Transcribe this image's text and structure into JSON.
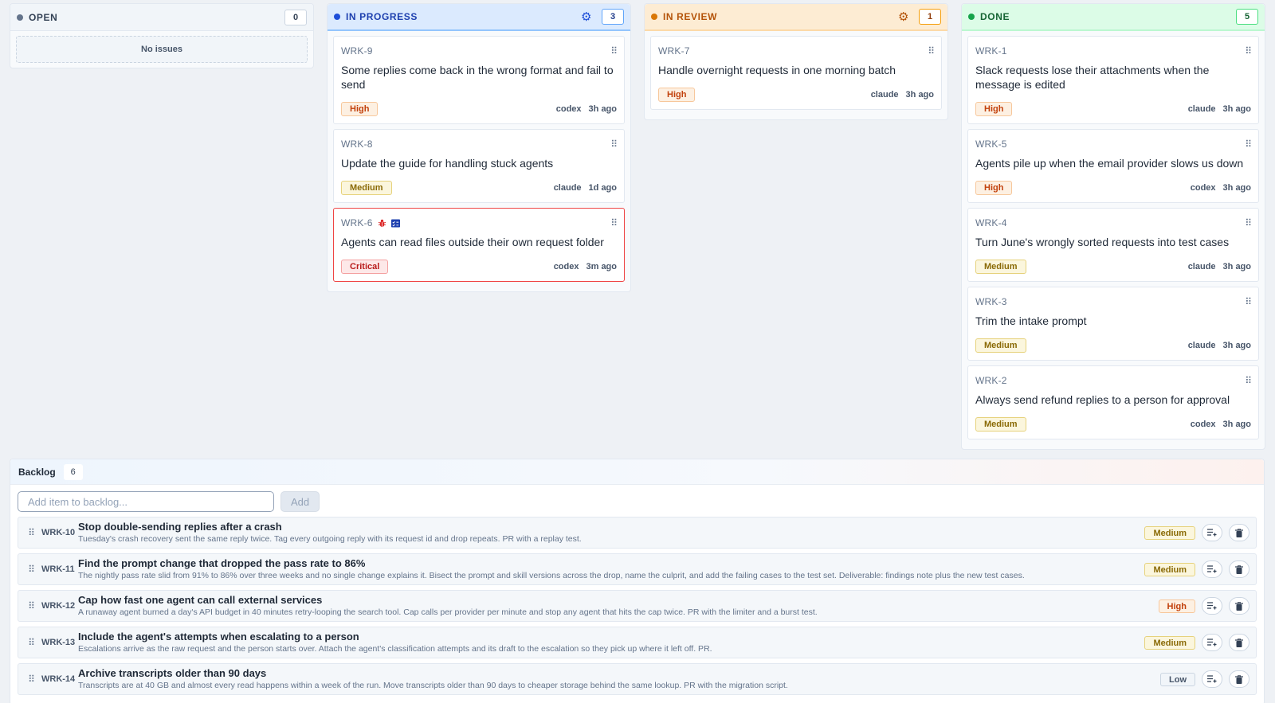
{
  "columns": {
    "open": {
      "label": "OPEN",
      "count": "0",
      "empty_text": "No issues"
    },
    "in_progress": {
      "label": "IN PROGRESS",
      "count": "3",
      "cards": [
        {
          "id": "WRK-9",
          "title": "Some replies come back in the wrong format and fail to send",
          "priority": "High",
          "agent": "codex",
          "time": "3h ago"
        },
        {
          "id": "WRK-8",
          "title": "Update the guide for handling stuck agents",
          "priority": "Medium",
          "agent": "claude",
          "time": "1d ago"
        },
        {
          "id": "WRK-6",
          "title": "Agents can read files outside their own request folder",
          "priority": "Critical",
          "agent": "codex",
          "time": "3m ago",
          "flags": [
            "bug-icon",
            "checklist-icon"
          ]
        }
      ]
    },
    "in_review": {
      "label": "IN REVIEW",
      "count": "1",
      "cards": [
        {
          "id": "WRK-7",
          "title": "Handle overnight requests in one morning batch",
          "priority": "High",
          "agent": "claude",
          "time": "3h ago"
        }
      ]
    },
    "done": {
      "label": "DONE",
      "count": "5",
      "cards": [
        {
          "id": "WRK-1",
          "title": "Slack requests lose their attachments when the message is edited",
          "priority": "High",
          "agent": "claude",
          "time": "3h ago"
        },
        {
          "id": "WRK-5",
          "title": "Agents pile up when the email provider slows us down",
          "priority": "High",
          "agent": "codex",
          "time": "3h ago"
        },
        {
          "id": "WRK-4",
          "title": "Turn June's wrongly sorted requests into test cases",
          "priority": "Medium",
          "agent": "claude",
          "time": "3h ago"
        },
        {
          "id": "WRK-3",
          "title": "Trim the intake prompt",
          "priority": "Medium",
          "agent": "claude",
          "time": "3h ago"
        },
        {
          "id": "WRK-2",
          "title": "Always send refund replies to a person for approval",
          "priority": "Medium",
          "agent": "codex",
          "time": "3h ago"
        }
      ]
    }
  },
  "backlog": {
    "title": "Backlog",
    "count": "6",
    "input_placeholder": "Add item to backlog...",
    "add_label": "Add",
    "items": [
      {
        "id": "WRK-10",
        "title": "Stop double-sending replies after a crash",
        "desc": "Tuesday's crash recovery sent the same reply twice. Tag every outgoing reply with its request id and drop repeats. PR with a replay test.",
        "priority": "Medium"
      },
      {
        "id": "WRK-11",
        "title": "Find the prompt change that dropped the pass rate to 86%",
        "desc": "The nightly pass rate slid from 91% to 86% over three weeks and no single change explains it. Bisect the prompt and skill versions across the drop, name the culprit, and add the failing cases to the test set. Deliverable: findings note plus the new test cases.",
        "priority": "Medium"
      },
      {
        "id": "WRK-12",
        "title": "Cap how fast one agent can call external services",
        "desc": "A runaway agent burned a day's API budget in 40 minutes retry-looping the search tool. Cap calls per provider per minute and stop any agent that hits the cap twice. PR with the limiter and a burst test.",
        "priority": "High"
      },
      {
        "id": "WRK-13",
        "title": "Include the agent's attempts when escalating to a person",
        "desc": "Escalations arrive as the raw request and the person starts over. Attach the agent's classification attempts and its draft to the escalation so they pick up where it left off. PR.",
        "priority": "Medium"
      },
      {
        "id": "WRK-14",
        "title": "Archive transcripts older than 90 days",
        "desc": "Transcripts are at 40 GB and almost every read happens within a week of the run. Move transcripts older than 90 days to cheaper storage behind the same lookup. PR with the migration script.",
        "priority": "Low"
      }
    ]
  },
  "icons": {
    "column_settings": "gear-icon",
    "drag": "drag-handle-icon",
    "move_to_board": "add-to-list-icon",
    "delete": "trash-icon"
  },
  "colors": {
    "in_progress_accent": "#1d4ed8",
    "in_review_accent": "#d97706",
    "done_accent": "#16a34a",
    "critical_border": "#ef4444"
  }
}
